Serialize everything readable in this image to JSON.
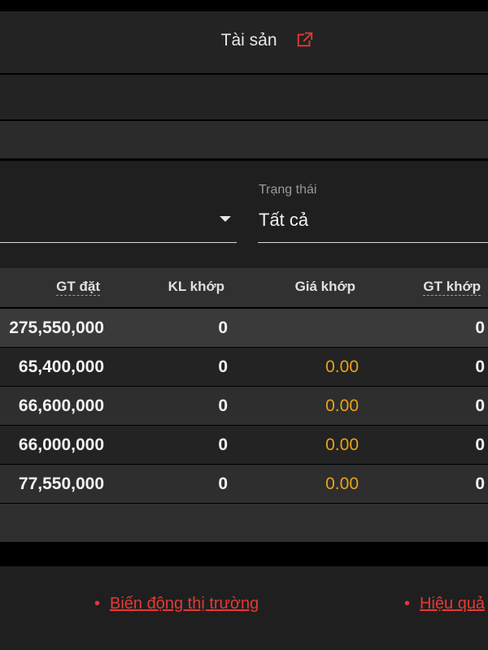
{
  "header": {
    "tab_title": "Tài sản",
    "icon": "external-link-icon"
  },
  "filters": {
    "status_label": "Trạng thái",
    "status_value": "Tất cả"
  },
  "table": {
    "columns": [
      "GT đặt",
      "KL khớp",
      "Giá khớp",
      "GT khớp"
    ],
    "summary": {
      "gt_dat": "275,550,000",
      "kl_khop": "0",
      "gia_khop": "",
      "gt_khop": "0"
    },
    "rows": [
      {
        "gt_dat": "65,400,000",
        "kl_khop": "0",
        "gia_khop": "0.00",
        "gt_khop": "0"
      },
      {
        "gt_dat": "66,600,000",
        "kl_khop": "0",
        "gia_khop": "0.00",
        "gt_khop": "0"
      },
      {
        "gt_dat": "66,000,000",
        "kl_khop": "0",
        "gia_khop": "0.00",
        "gt_khop": "0"
      },
      {
        "gt_dat": "77,550,000",
        "kl_khop": "0",
        "gia_khop": "0.00",
        "gt_khop": "0"
      }
    ]
  },
  "footer": {
    "links": [
      "Biến động thị trường",
      "Hiệu quả"
    ],
    "bullet": "•"
  },
  "colors": {
    "accent": "#e53935",
    "price": "#e8a318",
    "background": "#000000"
  }
}
